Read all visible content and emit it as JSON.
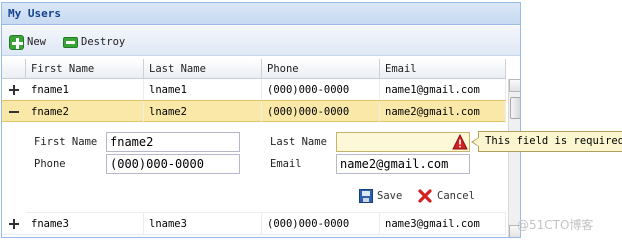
{
  "panel": {
    "title": "My Users"
  },
  "toolbar": {
    "new_label": "New",
    "destroy_label": "Destroy"
  },
  "columns": [
    "First Name",
    "Last Name",
    "Phone",
    "Email"
  ],
  "rows": [
    {
      "first": "fname1",
      "last": "lname1",
      "phone": "(000)000-0000",
      "email": "name1@gmail.com",
      "expanded": false
    },
    {
      "first": "fname2",
      "last": "lname2",
      "phone": "(000)000-0000",
      "email": "name2@gmail.com",
      "expanded": true
    },
    {
      "first": "fname3",
      "last": "lname3",
      "phone": "(000)000-0000",
      "email": "name3@gmail.com",
      "expanded": false
    }
  ],
  "editor": {
    "first_label": "First Name",
    "first_value": "fname2",
    "last_label": "Last Name",
    "last_value": "",
    "phone_label": "Phone",
    "phone_value": "(000)000-0000",
    "email_label": "Email",
    "email_value": "name2@gmail.com",
    "error_message": "This field is required.",
    "save_label": "Save",
    "cancel_label": "Cancel"
  },
  "watermark": "@51CTO博客",
  "colors": {
    "selected_row": "#fae8a8",
    "title_text": "#15428b",
    "accent_green": "#3aa43a",
    "error": "#cc2222"
  },
  "icons": [
    "plus-icon",
    "minus-icon",
    "warning-icon",
    "save-icon",
    "cancel-icon"
  ]
}
